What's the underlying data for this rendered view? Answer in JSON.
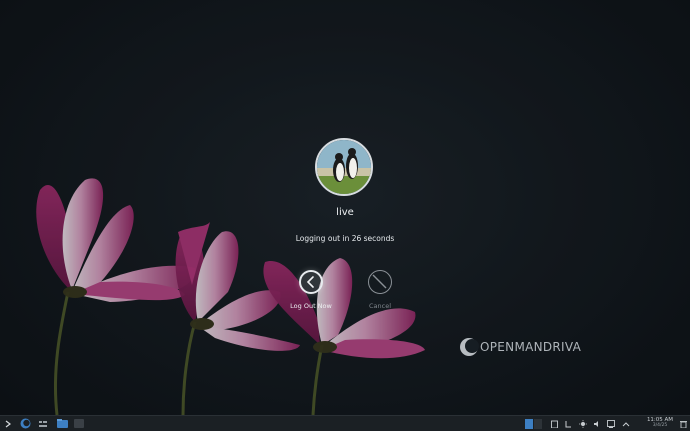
{
  "session": {
    "username": "live",
    "countdown_text": "Logging out in 26 seconds"
  },
  "actions": {
    "logout_label": "Log Out Now",
    "cancel_label": "Cancel"
  },
  "brand": {
    "name": "OPENMANDRIVA"
  },
  "taskbar": {
    "launcher_icon": "menu-chevron-icon",
    "time": "11:05 AM",
    "date": "3/4/25"
  },
  "colors": {
    "background": "#161d23",
    "flower_magenta": "#b2397d",
    "taskbar": "#1b2024",
    "accent_blue": "#3d7fc2"
  }
}
